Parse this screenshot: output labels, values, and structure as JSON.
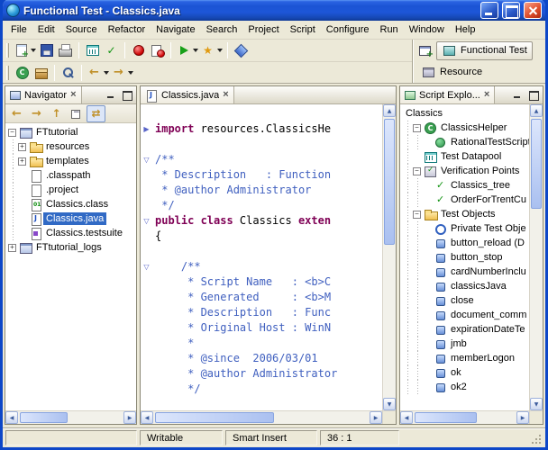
{
  "window": {
    "title": "Functional Test - Classics.java"
  },
  "menubar": {
    "items": [
      "File",
      "Edit",
      "Source",
      "Refactor",
      "Navigate",
      "Search",
      "Project",
      "Script",
      "Configure",
      "Run",
      "Window",
      "Help"
    ]
  },
  "toolbar": {
    "row1": [
      {
        "icon": "new-script",
        "caret": true
      },
      {
        "icon": "save"
      },
      {
        "icon": "print"
      },
      {
        "sep": true
      },
      {
        "icon": "new-datapool"
      },
      {
        "icon": "new-verification-point"
      },
      {
        "sep": true
      },
      {
        "icon": "record-script"
      },
      {
        "icon": "insert-recording"
      },
      {
        "sep": true
      },
      {
        "icon": "run-script",
        "caret": true
      },
      {
        "icon": "find-literals",
        "caret": true
      },
      {
        "sep": true
      },
      {
        "icon": "insert-test-object"
      }
    ],
    "row2": [
      {
        "icon": "new-java-class"
      },
      {
        "icon": "new-java-package"
      },
      {
        "sep": true
      },
      {
        "icon": "search"
      },
      {
        "sep": true
      },
      {
        "icon": "back",
        "caret": true
      },
      {
        "icon": "forward",
        "caret": true
      }
    ],
    "perspectives": [
      {
        "label": "Functional Test",
        "icon": "functional-test-perspective",
        "active": true
      },
      {
        "label": "Resource",
        "icon": "resource-perspective",
        "active": false
      }
    ]
  },
  "navigator": {
    "title": "Navigator",
    "toolbar": [
      {
        "icon": "back"
      },
      {
        "icon": "forward"
      },
      {
        "icon": "up"
      },
      {
        "icon": "collapse-all"
      },
      {
        "icon": "link-with-editor",
        "pressed": true
      }
    ],
    "tree": [
      {
        "label": "FTtutorial",
        "depth": 0,
        "icon": "project",
        "expander": "minus"
      },
      {
        "label": "resources",
        "depth": 1,
        "icon": "folder",
        "expander": "plus"
      },
      {
        "label": "templates",
        "depth": 1,
        "icon": "folder",
        "expander": "plus"
      },
      {
        "label": ".classpath",
        "depth": 1,
        "icon": "file"
      },
      {
        "label": ".project",
        "depth": 1,
        "icon": "file"
      },
      {
        "label": "Classics.class",
        "depth": 1,
        "icon": "class-file"
      },
      {
        "label": "Classics.java",
        "depth": 1,
        "icon": "java-file",
        "selected": true
      },
      {
        "label": "Classics.testsuite",
        "depth": 1,
        "icon": "testsuite-file"
      },
      {
        "label": "FTtutorial_logs",
        "depth": 0,
        "icon": "project",
        "expander": "plus"
      }
    ]
  },
  "editor": {
    "tab_label": "Classics.java",
    "lines": [
      {
        "fold": "",
        "segments": []
      },
      {
        "fold": "collapsed",
        "segments": [
          {
            "text": "import",
            "style": "keyword"
          },
          {
            "text": " resources.ClassicsHe",
            "style": "plain"
          }
        ]
      },
      {
        "fold": "",
        "segments": []
      },
      {
        "fold": "expanded",
        "segments": [
          {
            "text": "/**",
            "style": "doc"
          }
        ]
      },
      {
        "fold": "",
        "segments": [
          {
            "text": " * Description   : Function",
            "style": "doc"
          }
        ]
      },
      {
        "fold": "",
        "segments": [
          {
            "text": " * @author Administrator",
            "style": "doc"
          }
        ]
      },
      {
        "fold": "",
        "segments": [
          {
            "text": " */",
            "style": "doc"
          }
        ]
      },
      {
        "fold": "expanded",
        "segments": [
          {
            "text": "public class",
            "style": "keyword"
          },
          {
            "text": " Classics ",
            "style": "plain"
          },
          {
            "text": "exten",
            "style": "keyword"
          }
        ]
      },
      {
        "fold": "",
        "segments": [
          {
            "text": "{",
            "style": "plain"
          }
        ]
      },
      {
        "fold": "",
        "segments": []
      },
      {
        "fold": "expanded",
        "segments": [
          {
            "text": "    /**",
            "style": "doc"
          }
        ]
      },
      {
        "fold": "",
        "segments": [
          {
            "text": "     * Script Name   : <b>C",
            "style": "doc"
          }
        ]
      },
      {
        "fold": "",
        "segments": [
          {
            "text": "     * Generated     : <b>M",
            "style": "doc"
          }
        ]
      },
      {
        "fold": "",
        "segments": [
          {
            "text": "     * Description   : Func",
            "style": "doc"
          }
        ]
      },
      {
        "fold": "",
        "segments": [
          {
            "text": "     * Original Host : WinN",
            "style": "doc"
          }
        ]
      },
      {
        "fold": "",
        "segments": [
          {
            "text": "     *",
            "style": "doc"
          }
        ]
      },
      {
        "fold": "",
        "segments": [
          {
            "text": "     * @since  2006/03/01",
            "style": "doc"
          }
        ]
      },
      {
        "fold": "",
        "segments": [
          {
            "text": "     * @author Administrator",
            "style": "doc"
          }
        ]
      },
      {
        "fold": "",
        "segments": [
          {
            "text": "     */",
            "style": "doc"
          }
        ]
      }
    ]
  },
  "script_explorer": {
    "title": "Script Explo...",
    "tree": [
      {
        "label": "Classics",
        "depth": 0,
        "icon": "",
        "flush": true
      },
      {
        "label": "ClassicsHelper",
        "depth": 1,
        "icon": "helper-class",
        "expander": "minus"
      },
      {
        "label": "RationalTestScript",
        "depth": 2,
        "icon": "helper-superclass"
      },
      {
        "label": "Test Datapool",
        "depth": 1,
        "icon": "datapool"
      },
      {
        "label": "Verification Points",
        "depth": 1,
        "icon": "vp-group",
        "expander": "minus"
      },
      {
        "label": "Classics_tree",
        "depth": 2,
        "icon": "verification-point"
      },
      {
        "label": "OrderForTrentCu",
        "depth": 2,
        "icon": "verification-point"
      },
      {
        "label": "Test Objects",
        "depth": 1,
        "icon": "to-group",
        "expander": "minus"
      },
      {
        "label": "Private Test Obje",
        "depth": 2,
        "icon": "private-test-object"
      },
      {
        "label": "button_reload (D",
        "depth": 2,
        "icon": "test-object"
      },
      {
        "label": "button_stop",
        "depth": 2,
        "icon": "test-object"
      },
      {
        "label": "cardNumberInclu",
        "depth": 2,
        "icon": "test-object"
      },
      {
        "label": "classicsJava",
        "depth": 2,
        "icon": "test-object"
      },
      {
        "label": "close",
        "depth": 2,
        "icon": "test-object"
      },
      {
        "label": "document_comm",
        "depth": 2,
        "icon": "test-object"
      },
      {
        "label": "expirationDateTe",
        "depth": 2,
        "icon": "test-object"
      },
      {
        "label": "jmb",
        "depth": 2,
        "icon": "test-object"
      },
      {
        "label": "memberLogon",
        "depth": 2,
        "icon": "test-object"
      },
      {
        "label": "ok",
        "depth": 2,
        "icon": "test-object"
      },
      {
        "label": "ok2",
        "depth": 2,
        "icon": "test-object"
      }
    ]
  },
  "statusbar": {
    "writable": "Writable",
    "insert_mode": "Smart Insert",
    "caret_position": "36 : 1"
  }
}
